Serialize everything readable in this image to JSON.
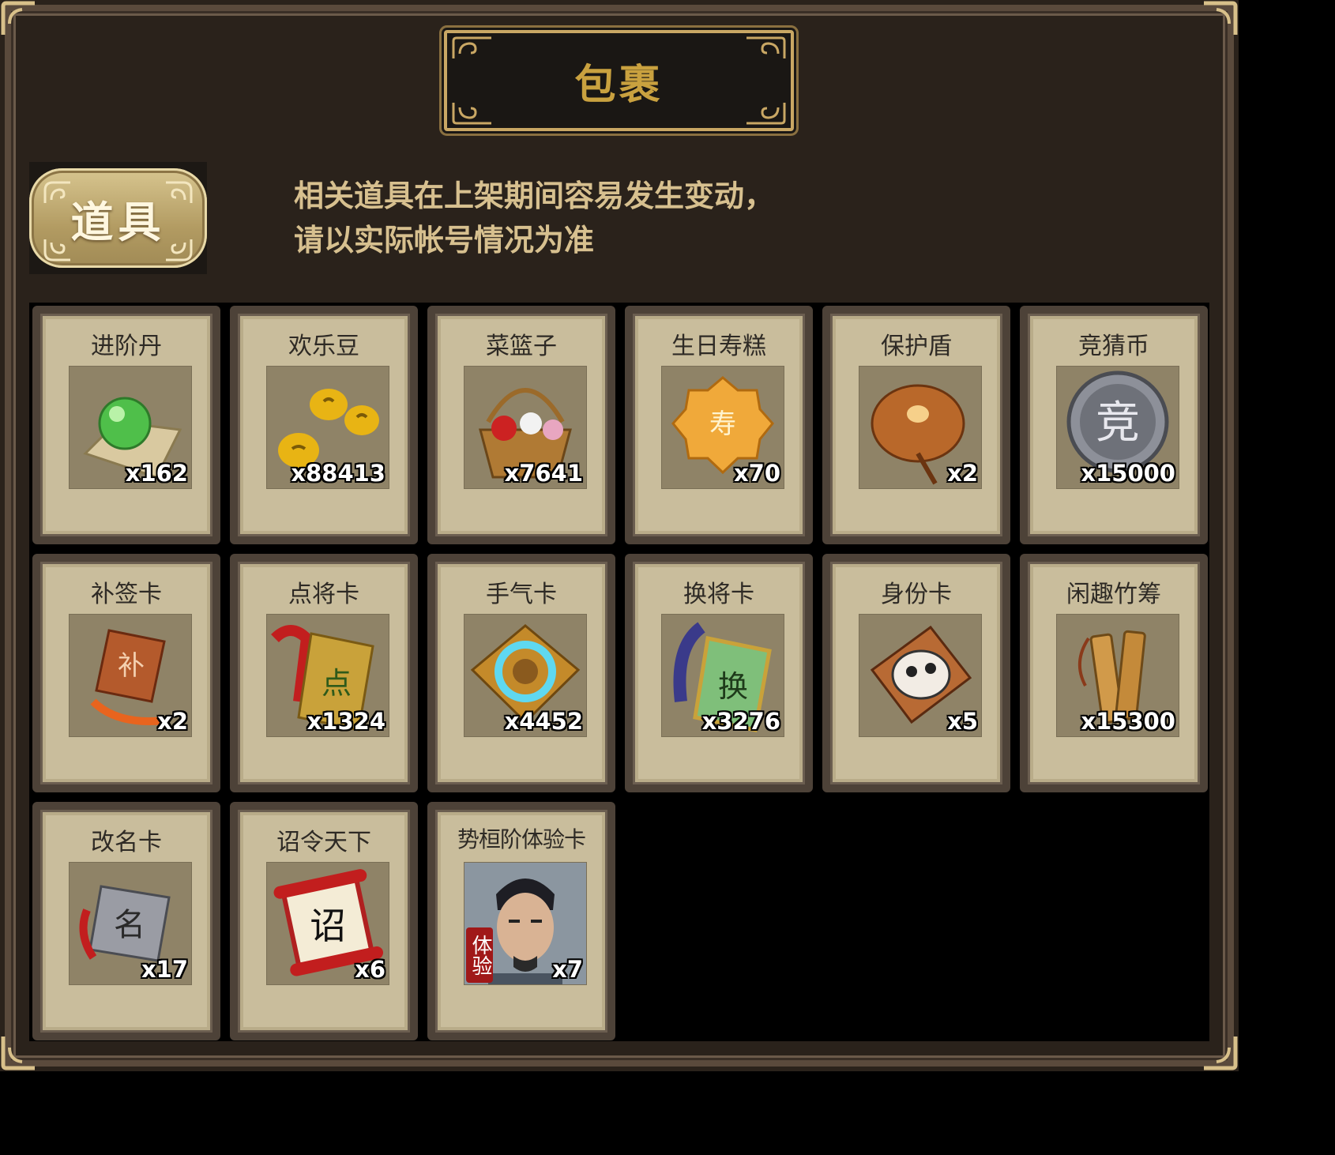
{
  "title": "包裹",
  "category_tab": "道具",
  "notice": {
    "line1": "相关道具在上架期间容易发生变动，",
    "line2": "请以实际帐号情况为准"
  },
  "items": [
    {
      "name": "进阶丹",
      "qty": "x162",
      "icon": "green-orb-icon"
    },
    {
      "name": "欢乐豆",
      "qty": "x88413",
      "icon": "gold-beans-icon"
    },
    {
      "name": "菜篮子",
      "qty": "x7641",
      "icon": "flower-basket-icon"
    },
    {
      "name": "生日寿糕",
      "qty": "x70",
      "icon": "birthday-cake-icon"
    },
    {
      "name": "保护盾",
      "qty": "x2",
      "icon": "shield-icon"
    },
    {
      "name": "竞猜币",
      "qty": "x15000",
      "icon": "silver-coin-icon"
    },
    {
      "name": "补签卡",
      "qty": "x2",
      "icon": "sign-card-icon"
    },
    {
      "name": "点将卡",
      "qty": "x1324",
      "icon": "general-card-icon"
    },
    {
      "name": "手气卡",
      "qty": "x4452",
      "icon": "luck-card-icon"
    },
    {
      "name": "换将卡",
      "qty": "x3276",
      "icon": "swap-card-icon"
    },
    {
      "name": "身份卡",
      "qty": "x5",
      "icon": "mask-card-icon"
    },
    {
      "name": "闲趣竹筹",
      "qty": "x15300",
      "icon": "bamboo-tokens-icon"
    },
    {
      "name": "改名卡",
      "qty": "x17",
      "icon": "rename-card-icon"
    },
    {
      "name": "诏令天下",
      "qty": "x6",
      "icon": "scroll-icon"
    },
    {
      "name": "势桓阶体验卡",
      "qty": "x7",
      "icon": "hero-portrait-icon",
      "badge": "体验"
    }
  ]
}
